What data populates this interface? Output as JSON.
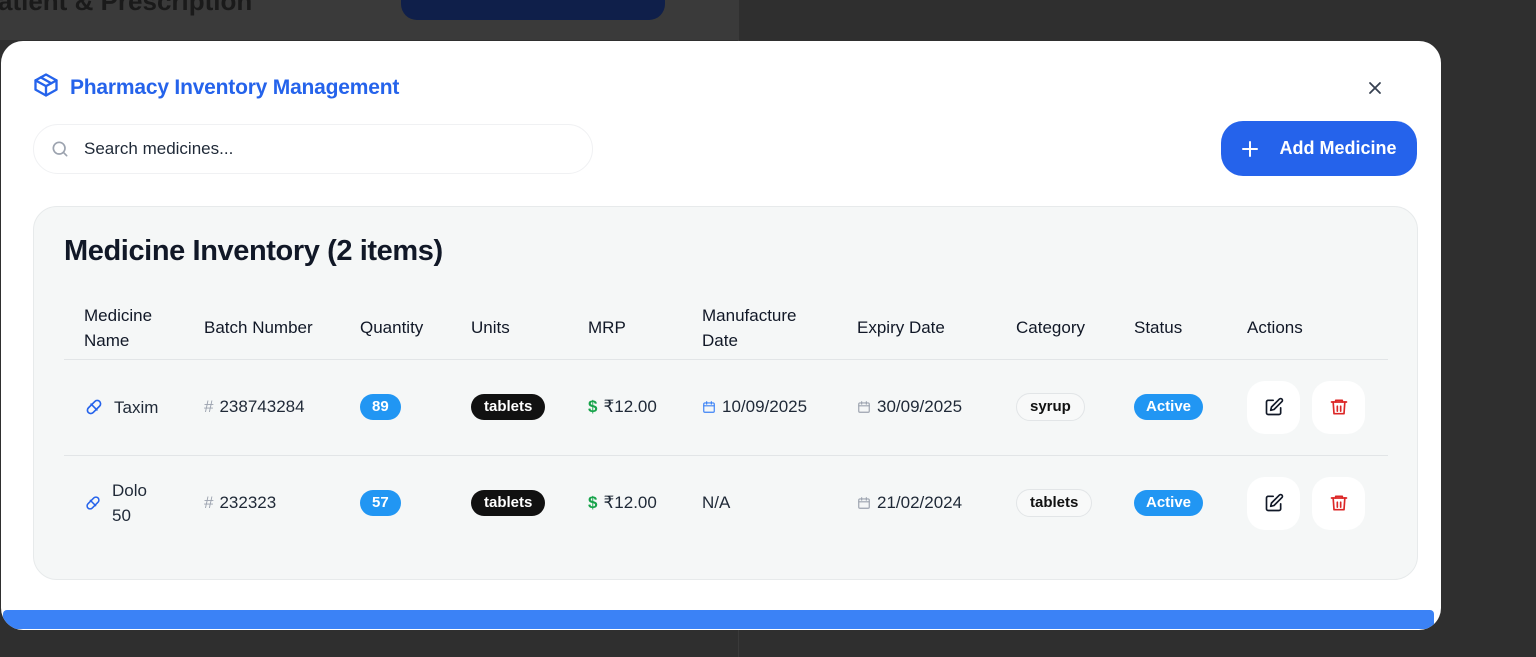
{
  "background": {
    "title": "atient & Prescription"
  },
  "modal": {
    "title": "Pharmacy Inventory Management",
    "search_placeholder": "Search medicines...",
    "add_button_label": "Add Medicine"
  },
  "inventory": {
    "title": "Medicine Inventory (2 items)",
    "columns": {
      "name": "Medicine Name",
      "batch": "Batch Number",
      "quantity": "Quantity",
      "units": "Units",
      "mrp": "MRP",
      "manufacture": "Manufacture Date",
      "expiry": "Expiry Date",
      "category": "Category",
      "status": "Status",
      "actions": "Actions"
    },
    "rows": [
      {
        "name": "Taxim",
        "batch": "238743284",
        "quantity": "89",
        "units": "tablets",
        "mrp": "₹12.00",
        "manufacture": "10/09/2025",
        "expiry": "30/09/2025",
        "category": "syrup",
        "status": "Active"
      },
      {
        "name": "Dolo 50",
        "batch": "232323",
        "quantity": "57",
        "units": "tablets",
        "mrp": "₹12.00",
        "manufacture": "N/A",
        "expiry": "21/02/2024",
        "category": "tablets",
        "status": "Active"
      }
    ]
  },
  "symbols": {
    "hash": "#",
    "dollar": "$"
  },
  "icons": {
    "header": "package-icon",
    "close": "close-icon",
    "search": "search-icon",
    "add": "plus-icon",
    "medicine": "pill-icon",
    "batch": "hash-icon",
    "price": "dollar-icon",
    "date": "calendar-icon",
    "edit": "edit-icon",
    "delete": "trash-icon"
  },
  "colors": {
    "accent": "#2563eb",
    "badge_blue": "#2196f3",
    "units_badge": "#111111",
    "price_icon": "#16a34a",
    "delete_icon": "#dc2626"
  }
}
